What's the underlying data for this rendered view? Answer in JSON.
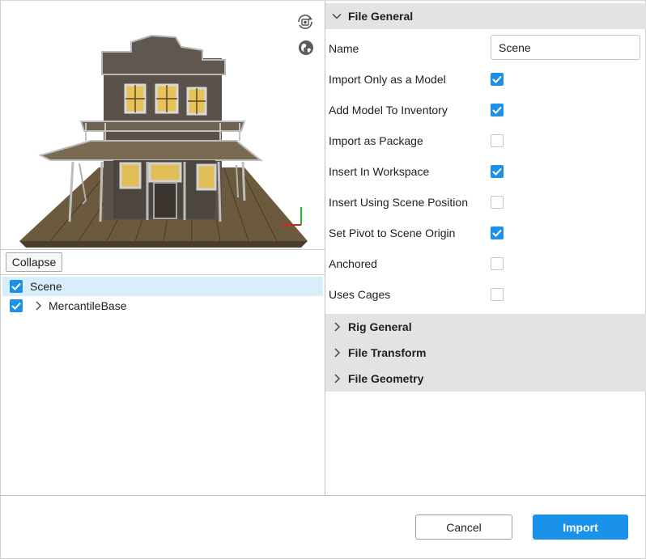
{
  "viewport": {
    "reset_view_icon": "camera-reset-icon",
    "globe_icon": "globe-icon",
    "preview": "3d-model-preview",
    "axis_icon": "axis-gizmo-icon"
  },
  "tree": {
    "collapse_label": "Collapse",
    "items": [
      {
        "label": "Scene",
        "checked": true,
        "selected": true
      },
      {
        "label": "MercantileBase",
        "checked": true,
        "selected": false
      }
    ]
  },
  "file_general": {
    "title": "File General",
    "name_label": "Name",
    "name_value": "Scene",
    "options": [
      {
        "label": "Import Only as a Model",
        "checked": true
      },
      {
        "label": "Add Model To Inventory",
        "checked": true
      },
      {
        "label": "Import as Package",
        "checked": false
      },
      {
        "label": "Insert In Workspace",
        "checked": true
      },
      {
        "label": "Insert Using Scene Position",
        "checked": false
      },
      {
        "label": "Set Pivot to Scene Origin",
        "checked": true
      },
      {
        "label": "Anchored",
        "checked": false
      },
      {
        "label": "Uses Cages",
        "checked": false
      }
    ]
  },
  "collapsed_sections": [
    {
      "title": "Rig General"
    },
    {
      "title": "File Transform"
    },
    {
      "title": "File Geometry"
    }
  ],
  "footer": {
    "cancel_label": "Cancel",
    "import_label": "Import"
  },
  "colors": {
    "accent": "#1a92ea",
    "checkbox_on": "#1e90e8",
    "selection": "#d8eefb",
    "section_header": "#e3e3e3"
  }
}
